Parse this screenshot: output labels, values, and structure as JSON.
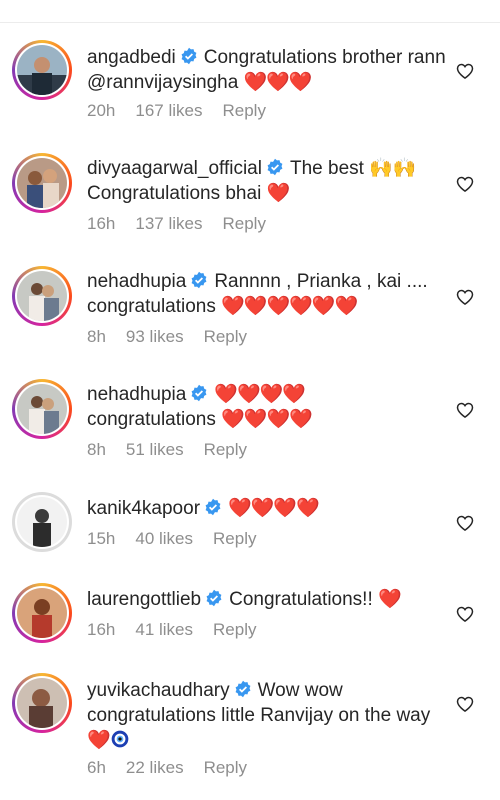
{
  "comments": [
    {
      "username": "angadbedi",
      "text": "Congratulations brother rann @rannvijaysingha",
      "hearts": "❤️❤️❤️",
      "time": "20h",
      "likes": "167 likes",
      "reply": "Reply"
    },
    {
      "username": "divyaagarwal_official",
      "text": "The best",
      "emoji": "🙌🙌",
      "text2": "Congratulations bhai",
      "hearts": "❤️",
      "time": "16h",
      "likes": "137 likes",
      "reply": "Reply"
    },
    {
      "username": "nehadhupia",
      "text": "Rannnn , Prianka , kai ....",
      "text2": "congratulations",
      "hearts": "❤️❤️❤️❤️❤️❤️",
      "time": "8h",
      "likes": "93 likes",
      "reply": "Reply"
    },
    {
      "username": "nehadhupia",
      "hearts_first": "❤️❤️❤️❤️",
      "text2": "congratulations",
      "hearts": "❤️❤️❤️❤️",
      "time": "8h",
      "likes": "51 likes",
      "reply": "Reply"
    },
    {
      "username": "kanik4kapoor",
      "hearts_first": "❤️❤️❤️❤️",
      "time": "15h",
      "likes": "40 likes",
      "reply": "Reply"
    },
    {
      "username": "laurengottlieb",
      "text": "Congratulations!!",
      "hearts": "❤️",
      "time": "16h",
      "likes": "41 likes",
      "reply": "Reply"
    },
    {
      "username": "yuvikachaudhary",
      "text": "Wow wow congratulations little Ranvijay on the way",
      "hearts": "❤️",
      "emoji": "🧿",
      "time": "6h",
      "likes": "22 likes",
      "reply": "Reply"
    }
  ],
  "colors": {
    "verified_badge": "#3897f0",
    "heart": "#e0162b",
    "meta_text": "#8e8e8e",
    "story_ring": "#d6249f"
  },
  "icons": {
    "verified": "verified-badge-icon",
    "like": "heart-outline-icon"
  }
}
